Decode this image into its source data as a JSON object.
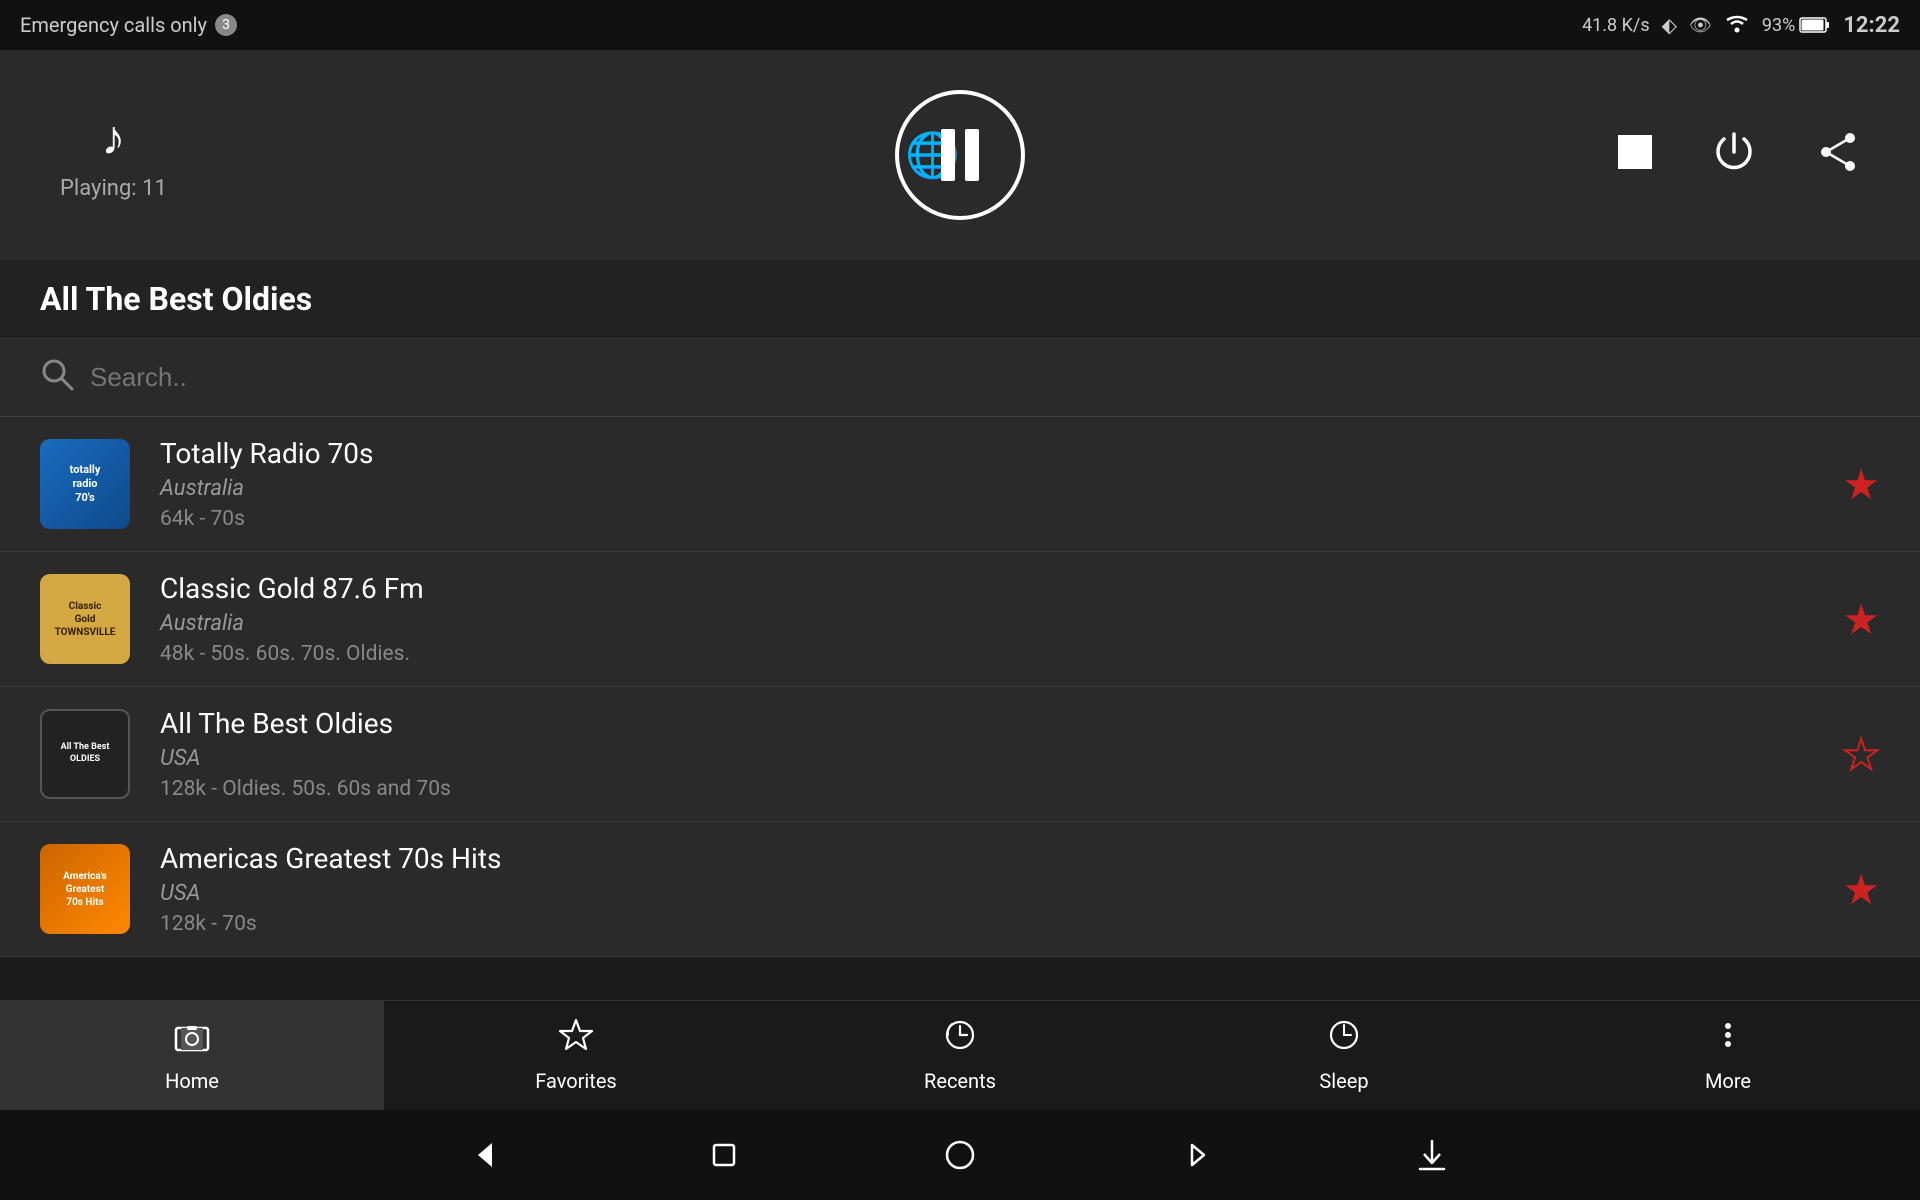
{
  "statusBar": {
    "emergencyText": "Emergency calls only",
    "badge": "3",
    "speed": "41.8 K/s",
    "time": "12:22",
    "battery": "93%"
  },
  "player": {
    "playingText": "Playing: 11",
    "currentStation": "All The Best Oldies",
    "globeIcon": "🌐",
    "musicIcon": "♪"
  },
  "search": {
    "placeholder": "Search.."
  },
  "stations": [
    {
      "id": 1,
      "name": "Totally Radio 70s",
      "country": "Australia",
      "bitrate": "64k - 70s",
      "logoClass": "logo-70s",
      "logoText": "totally\nradio\n70's",
      "favorited": true
    },
    {
      "id": 2,
      "name": "Classic Gold 87.6 Fm",
      "country": "Australia",
      "bitrate": "48k - 50s. 60s. 70s. Oldies.",
      "logoClass": "logo-classic",
      "logoText": "Classic\nGold\nTOWNSVILLE",
      "favorited": true
    },
    {
      "id": 3,
      "name": "All The Best Oldies",
      "country": "USA",
      "bitrate": "128k - Oldies. 50s. 60s and 70s",
      "logoClass": "logo-oldies",
      "logoText": "All The Best\nOLDIES",
      "favorited": false
    },
    {
      "id": 4,
      "name": "Americas Greatest 70s Hits",
      "country": "USA",
      "bitrate": "128k - 70s",
      "logoClass": "logo-americas",
      "logoText": "America's\nGreatest\n70s Hits",
      "favorited": true
    }
  ],
  "navItems": [
    {
      "id": "home",
      "label": "Home",
      "icon": "home",
      "active": true
    },
    {
      "id": "favorites",
      "label": "Favorites",
      "icon": "star",
      "active": false
    },
    {
      "id": "recents",
      "label": "Recents",
      "icon": "recents",
      "active": false
    },
    {
      "id": "sleep",
      "label": "Sleep",
      "icon": "sleep",
      "active": false
    },
    {
      "id": "more",
      "label": "More",
      "icon": "more",
      "active": false
    }
  ]
}
